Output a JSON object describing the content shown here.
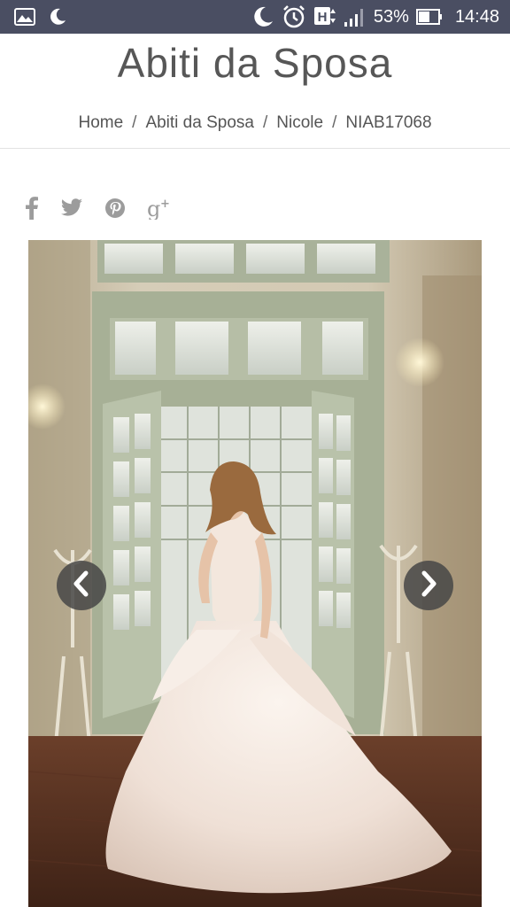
{
  "status_bar": {
    "battery_percent": "53%",
    "time": "14:48",
    "network_label": "H",
    "icons": [
      "gallery-icon",
      "moon-icon",
      "night-mode-icon",
      "alarm-icon",
      "h-network-icon",
      "signal-icon",
      "battery-icon"
    ]
  },
  "header": {
    "title": "Abiti da Sposa"
  },
  "breadcrumb": {
    "items": [
      "Home",
      "Abiti da Sposa",
      "Nicole",
      "NIAB17068"
    ],
    "separator": "/"
  },
  "share": {
    "icons": [
      "facebook-icon",
      "twitter-icon",
      "pinterest-icon",
      "google-plus-icon"
    ]
  },
  "gallery": {
    "image_subject": "bride-wedding-dress-photo",
    "prev_icon": "chevron-left-icon",
    "next_icon": "chevron-right-icon"
  },
  "colors": {
    "status_bar_bg": "#4a4e62",
    "title_text": "#575757",
    "share_icon": "#9c9c9c",
    "nav_button_bg": "#464646"
  }
}
